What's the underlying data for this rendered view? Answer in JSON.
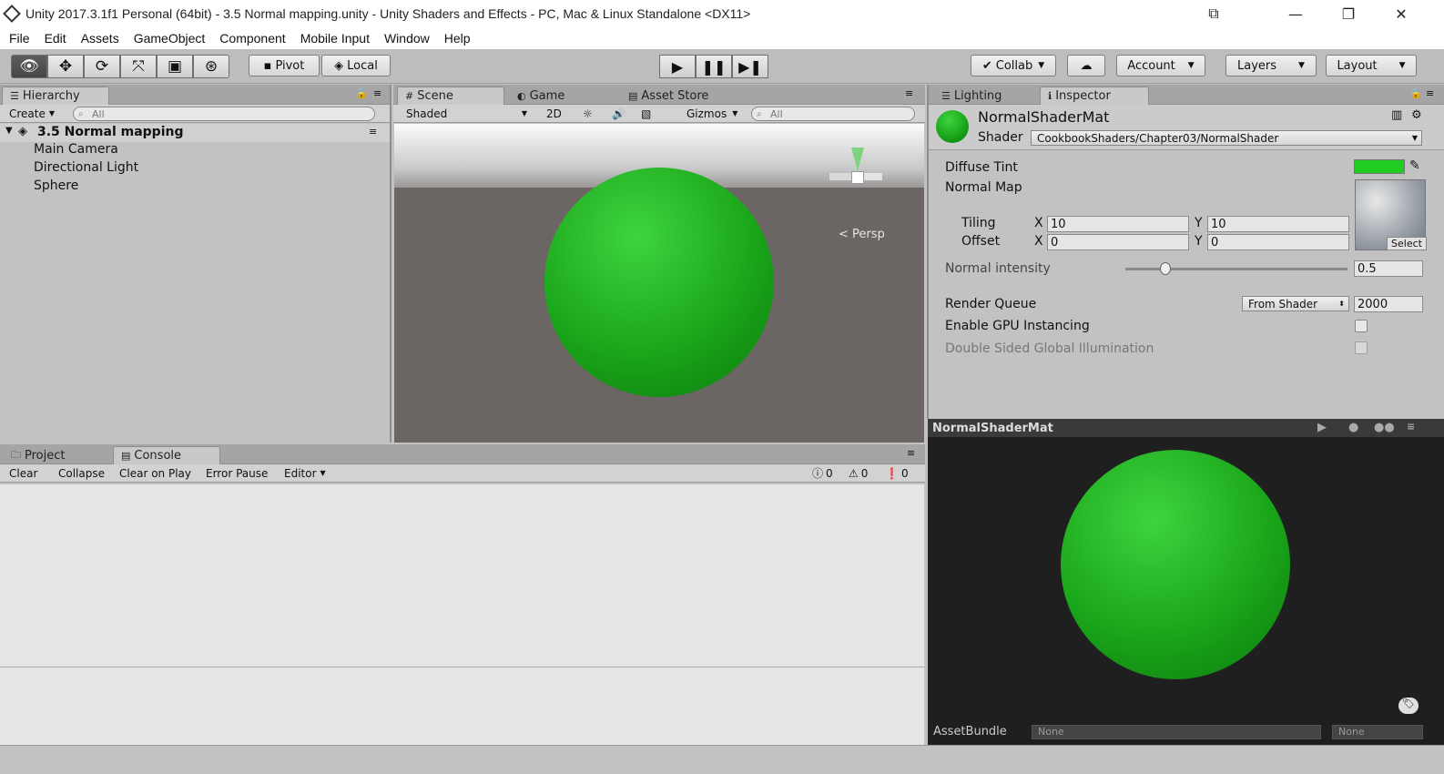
{
  "window": {
    "title": "Unity 2017.3.1f1 Personal (64bit) - 3.5 Normal mapping.unity - Unity Shaders and Effects - PC, Mac & Linux Standalone <DX11>"
  },
  "menu": [
    "File",
    "Edit",
    "Assets",
    "GameObject",
    "Component",
    "Mobile Input",
    "Window",
    "Help"
  ],
  "toolbar": {
    "pivot": "Pivot",
    "local": "Local",
    "collab": "Collab",
    "account": "Account",
    "layers": "Layers",
    "layout": "Layout"
  },
  "hierarchy": {
    "tab": "Hierarchy",
    "create": "Create",
    "search": "All",
    "scene": "3.5 Normal mapping",
    "items": [
      "Main Camera",
      "Directional Light",
      "Sphere"
    ]
  },
  "scene": {
    "tabs": [
      "Scene",
      "Game",
      "Asset Store"
    ],
    "shading": "Shaded",
    "mode2d": "2D",
    "gizmos": "Gizmos",
    "search": "All",
    "persp": "Persp"
  },
  "inspector": {
    "tabs": [
      "Lighting",
      "Inspector"
    ],
    "material": "NormalShaderMat",
    "shader_label": "Shader",
    "shader": "CookbookShaders/Chapter03/NormalShader",
    "diffuse": "Diffuse Tint",
    "normal_map": "Normal Map",
    "tiling": "Tiling",
    "offset": "Offset",
    "tiling_x": "10",
    "tiling_y": "10",
    "offset_x": "0",
    "offset_y": "0",
    "x": "X",
    "y": "Y",
    "select": "Select",
    "normal_intensity": "Normal intensity",
    "normal_intensity_value": "0.5",
    "render_queue": "Render Queue",
    "render_queue_mode": "From Shader",
    "render_queue_value": "2000",
    "gpu": "Enable GPU Instancing",
    "double_sided": "Double Sided Global Illumination",
    "tint_color": "#22cc22"
  },
  "preview": {
    "title": "NormalShaderMat",
    "assetbundle": "AssetBundle",
    "none1": "None",
    "none2": "None"
  },
  "console": {
    "tabs": [
      "Project",
      "Console"
    ],
    "buttons": [
      "Clear",
      "Collapse",
      "Clear on Play",
      "Error Pause",
      "Editor"
    ],
    "counts": [
      "0",
      "0",
      "0"
    ]
  }
}
